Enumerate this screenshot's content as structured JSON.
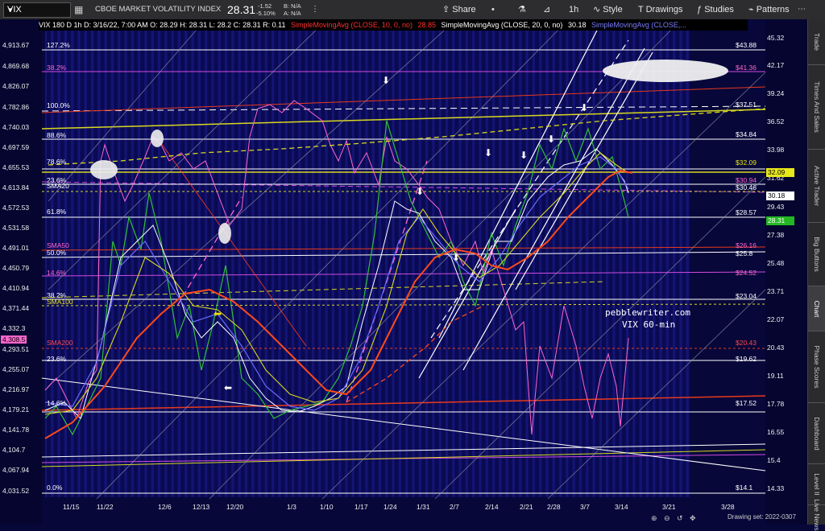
{
  "toolbar": {
    "symbol": "VIX",
    "instrument": "CBOE MARKET VOLATILITY INDEX",
    "last": "28.31",
    "change": "-1.52",
    "change_pct": "-5.10%",
    "bid_label": "B: N/A",
    "ask_label": "A: N/A",
    "share": "Share",
    "interval": "1h",
    "style": "Style",
    "drawings": "Drawings",
    "studies": "Studies",
    "patterns": "Patterns"
  },
  "legend": {
    "ohlc": "VIX 180 D 1h  D: 3/16/22, 7:00 AM  O: 28.29  H: 28.31  L: 28.2  C: 28.31  R: 0.11",
    "sma10": "SimpleMovingAvg (CLOSE, 10, 0, no)",
    "sma10_val": "28.85",
    "sma20": "SimpleMovingAvg (CLOSE, 20, 0, no)",
    "sma20_val": "30.18",
    "sma50": "SimpleMovingAvg (CLOSE,..."
  },
  "left_axis": [
    "4,913.67",
    "4,869.68",
    "4,826.07",
    "4,782.86",
    "4,740.03",
    "4,697.59",
    "4,655.53",
    "4,613.84",
    "4,572.53",
    "4,531.58",
    "4,491.01",
    "4,450.79",
    "4,410.94",
    "4,371.44",
    "4,332.3",
    "4,293.51",
    "4,255.07",
    "4,216.97",
    "4,179.21",
    "4,141.78",
    "4,104.7",
    "4,067.94",
    "4,031.52"
  ],
  "left_badge": "4,308.5",
  "right_axis": [
    "45.32",
    "43.88",
    "42.17",
    "39.24",
    "37.51",
    "36.52",
    "34.84",
    "33.98",
    "32.09",
    "31.62",
    "30.46",
    "30.18",
    "29.43",
    "28.31",
    "27.38",
    "26.16",
    "25.48",
    "24.52",
    "23.71",
    "23.04",
    "22.07",
    "20.43",
    "19.11",
    "19.62",
    "17.78",
    "17.52",
    "16.55",
    "15.4",
    "14.33",
    "14.1"
  ],
  "right_badges": {
    "b1": "32.09",
    "b2": "30.18",
    "b3": "28.31"
  },
  "fib_labels": [
    "127.2%",
    "38.2%",
    "100.0%",
    "88.6%",
    "78.6%",
    "23.6%",
    "61.8%",
    "50.0%",
    "14.6%",
    "38.2%",
    "23.6%",
    "14.6%",
    "0.0%"
  ],
  "sma_labels": [
    "SMA20",
    "SMA50",
    "SMA100",
    "SMA200"
  ],
  "level_marks": [
    "$43.88",
    "$41.36",
    "$37.51",
    "$34.84",
    "$32.09",
    "$30.94",
    "$30.46",
    "$28.57",
    "$26.16",
    "$25.8",
    "$24.52",
    "$23.04",
    "$20.43",
    "$19.62",
    "$17.52",
    "$14.1"
  ],
  "x_axis": [
    "11/15",
    "11/22",
    "12/6",
    "12/13",
    "12/20",
    "1/3",
    "1/10",
    "1/17",
    "1/24",
    "1/31",
    "2/7",
    "2/14",
    "2/21",
    "2/28",
    "3/7",
    "3/14",
    "3/21",
    "3/28"
  ],
  "watermark": {
    "line1": "pebblewriter.com",
    "line2": "VIX 60-min"
  },
  "drawing_set": "Drawing set: 2022-0307",
  "right_panel_tabs": [
    "Trade",
    "Times And Sales",
    "Active Trader",
    "Big Buttons",
    "Chart",
    "Phase Scores",
    "Dashboard",
    "Level II",
    "Live News"
  ],
  "colors": {
    "bg": "#07073a",
    "accent_blue": "#1e90ff",
    "pink": "#ff66cc",
    "orange_sma": "#ff4a1a",
    "yellow": "#e8e81a",
    "price_green": "#23b823"
  }
}
